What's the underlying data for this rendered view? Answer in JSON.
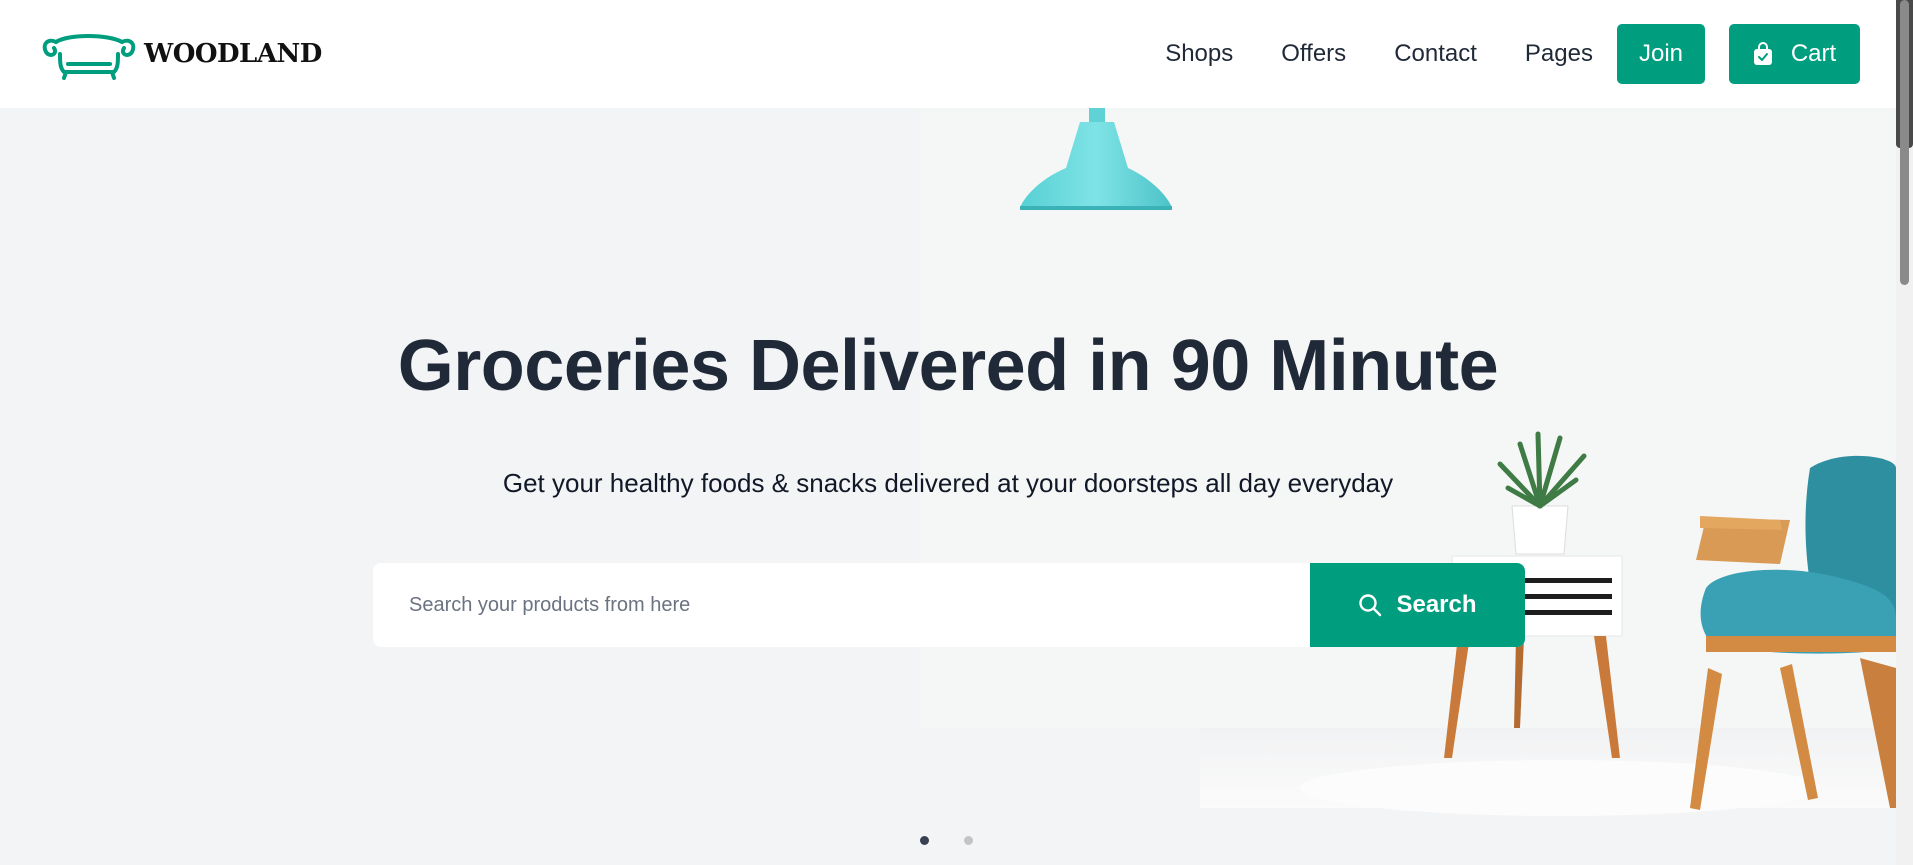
{
  "brand": {
    "name": "WOODLAND",
    "accent_color": "#009e7f"
  },
  "nav": {
    "links": [
      {
        "label": "Shops"
      },
      {
        "label": "Offers"
      },
      {
        "label": "Contact"
      },
      {
        "label": "Pages"
      }
    ],
    "join_label": "Join",
    "cart_label": "Cart",
    "cart_icon": "shopping-bag-icon"
  },
  "hero": {
    "title": "Groceries Delivered in 90 Minute",
    "subtitle": "Get your healthy foods & snacks delivered at your doorsteps all day everyday",
    "search_placeholder": "Search your products from here",
    "search_button_label": "Search",
    "search_icon": "search-icon",
    "slides": {
      "count": 2,
      "active_index": 0
    }
  }
}
